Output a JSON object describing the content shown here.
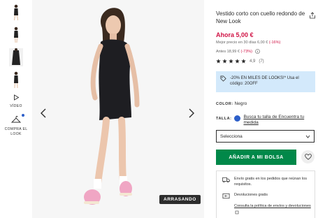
{
  "thumbnails": {
    "video_label": "VÍDEO",
    "shop_look_label": "COMPRA EL LOOK"
  },
  "gallery": {
    "badge": "ARRASANDO"
  },
  "product": {
    "title": "Vestido corto con cuello redondo de New Look",
    "price": "Ahora 5,00 €",
    "best_price_prefix": "Mejor precio en 30 días 6,00 € ",
    "best_price_discount": "(-16%)",
    "before_price_prefix": "Antes 18,99 € ",
    "before_price_discount": "(-73%)",
    "rating_value": "4,9",
    "rating_count": "(7)",
    "stars_filled": 5,
    "promo_text": "-20% EN MILES DE LOOKS!* Usa el código: 20OFF",
    "color_label": "COLOR:",
    "color_value": "Negro",
    "size_label": "TALLA:",
    "size_link": "Busca tu talla de Encuentra tu medida",
    "size_select": "Selecciona",
    "add_to_bag": "AÑADIR A MI BOLSA",
    "delivery_free": "Envío gratis en los pedidos que reúnan los requisitos.",
    "returns_free": "Devoluciones gratis",
    "policy_link": "Consulta la política de envíos y devoluciones"
  },
  "colors": {
    "price_red": "#d01345",
    "add_green": "#018849",
    "promo_blue": "#d3e9fb"
  }
}
